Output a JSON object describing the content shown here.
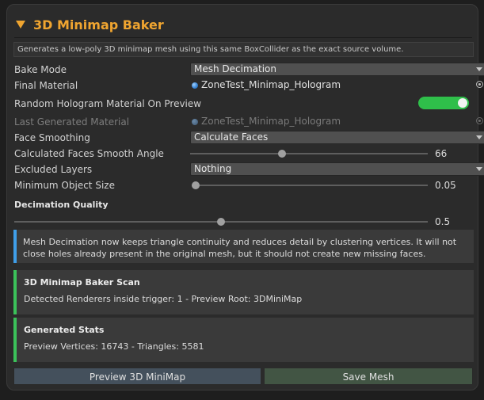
{
  "header": {
    "title": "3D Minimap Baker"
  },
  "description": "Generates a low-poly 3D minimap mesh using this same BoxCollider as the exact source volume.",
  "fields": {
    "bake_mode": {
      "label": "Bake Mode",
      "value": "Mesh Decimation"
    },
    "final_material": {
      "label": "Final Material",
      "value": "ZoneTest_Minimap_Hologram"
    },
    "random_hologram": {
      "label": "Random Hologram Material On Preview",
      "enabled": true
    },
    "last_generated_material": {
      "label": "Last Generated Material",
      "value": "ZoneTest_Minimap_Hologram"
    },
    "face_smoothing": {
      "label": "Face Smoothing",
      "value": "Calculate Faces"
    },
    "smooth_angle": {
      "label": "Calculated Faces Smooth Angle",
      "value": "66",
      "fraction": 0.37
    },
    "excluded_layers": {
      "label": "Excluded Layers",
      "value": "Nothing"
    },
    "min_object_size": {
      "label": "Minimum Object Size",
      "value": "0.05",
      "fraction": 0.0
    }
  },
  "decimation": {
    "title": "Decimation Quality",
    "value": "0.5",
    "fraction": 0.5
  },
  "help_text": "Mesh Decimation now keeps triangle continuity and reduces detail by clustering vertices. It will not close holes already present in the original mesh, but it should not create new missing faces.",
  "scan": {
    "title": "3D Minimap Baker Scan",
    "text": "Detected Renderers inside trigger: 1 - Preview Root: 3DMiniMap"
  },
  "stats": {
    "title": "Generated Stats",
    "text": "Preview Vertices: 16743 - Triangles: 5581"
  },
  "buttons": {
    "preview": "Preview 3D MiniMap",
    "save": "Save Mesh"
  },
  "colors": {
    "accent": "#f0a530",
    "toggle_on": "#2fbf4a",
    "info_bar": "#3f9ee8",
    "ok_bar": "#3bc25a"
  }
}
